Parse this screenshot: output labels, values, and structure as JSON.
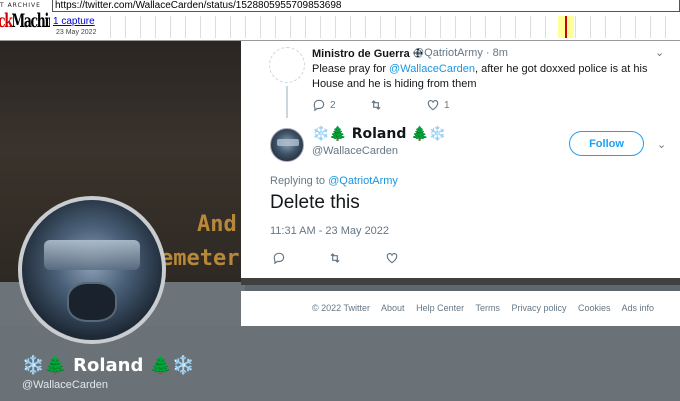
{
  "wayback": {
    "logo_top": "T ARCHIVE",
    "logo_main_red": "ck",
    "logo_main": "Machine",
    "url": "https://twitter.com/WallaceCarden/status/1528805955709853698",
    "captures": "1 capture",
    "date": "23 May 2022"
  },
  "banner": {
    "line1": "And",
    "line2": "emeter"
  },
  "profile": {
    "name_prefix": "❄️🌲",
    "name": "Roland",
    "name_suffix": "🌲❄️",
    "handle": "@WallaceCarden"
  },
  "parent_tweet": {
    "name": "Ministro de Guerra ☩",
    "handle_time": "@QatriotArmy · 8m",
    "text_before": "Please pray for ",
    "mention": "@WallaceCarden",
    "text_after": ", after he got doxxed police is at his House and he is hiding from them",
    "replies": "2",
    "likes": "1"
  },
  "main_tweet": {
    "name": "❄️🌲 Roland 🌲❄️",
    "handle": "@WallaceCarden",
    "follow_label": "Follow",
    "replying_label": "Replying to ",
    "replying_mention": "@QatriotArmy",
    "text": "Delete this",
    "timestamp": "11:31 AM - 23 May 2022"
  },
  "footer": {
    "links": [
      "© 2022 Twitter",
      "About",
      "Help Center",
      "Terms",
      "Privacy policy",
      "Cookies",
      "Ads info"
    ]
  },
  "colors": {
    "accent": "#1da1f2",
    "mention": "#1b95e0",
    "secondary_text": "#657786"
  }
}
